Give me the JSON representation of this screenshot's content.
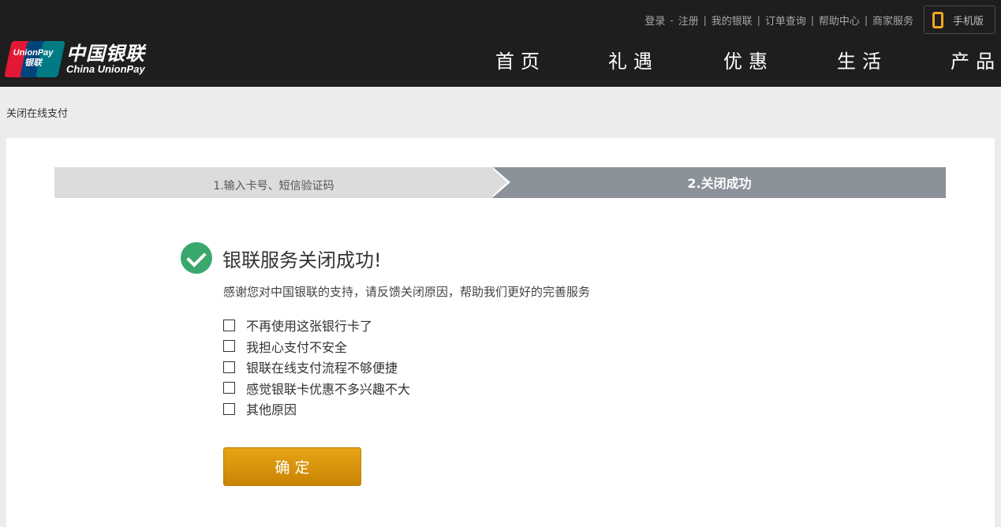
{
  "header": {
    "top_links": [
      "登录",
      "注册",
      "我的银联",
      "订单查询",
      "帮助中心",
      "商家服务"
    ],
    "top_link_separators": [
      "-",
      "|",
      "|",
      "|",
      "|"
    ],
    "mobile_label": "手机版",
    "logo": {
      "mark_line1": "UnionPay",
      "mark_line2": "银联",
      "cn": "中国银联",
      "en": "China UnionPay"
    },
    "nav": [
      "首页",
      "礼遇",
      "优惠",
      "生活",
      "产品"
    ]
  },
  "breadcrumb": "关闭在线支付",
  "steps": {
    "step1": "1.输入卡号、短信验证码",
    "step2": "2.关闭成功"
  },
  "result": {
    "title": "银联服务关闭成功!",
    "thanks": "感谢您对中国银联的支持，请反馈关闭原因，帮助我们更好的完善服务"
  },
  "reasons": [
    "不再使用这张银行卡了",
    "我担心支付不安全",
    "银联在线支付流程不够便捷",
    "感觉银联卡优惠不多兴趣不大",
    "其他原因"
  ],
  "confirm_label": "确定",
  "colors": {
    "header_bg": "#1e1e1e",
    "page_bg": "#ececec",
    "step_active": "#8b9199",
    "step_inactive": "#dcdcdc",
    "success_green": "#3aa76d",
    "button_orange": "#d8940c",
    "phone_icon": "#f0a81f"
  }
}
